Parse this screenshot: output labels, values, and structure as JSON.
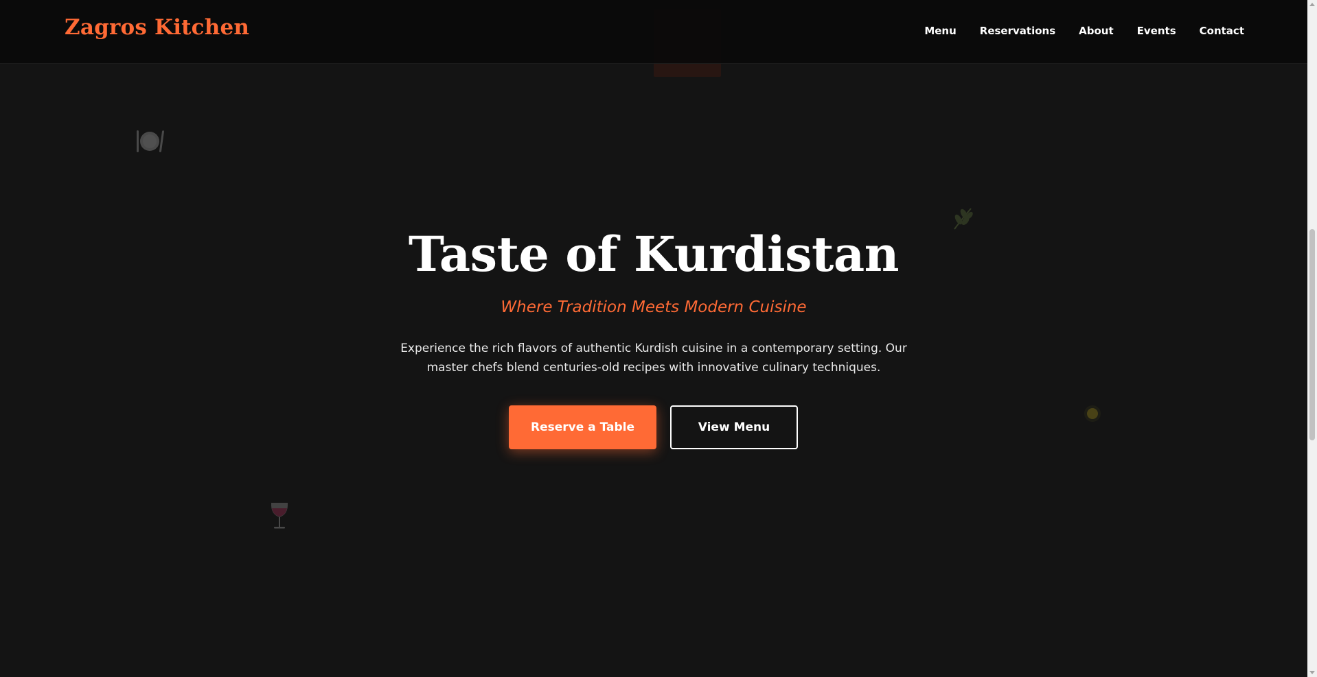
{
  "navbar": {
    "logo": "Zagros Kitchen",
    "links": [
      "Menu",
      "Reservations",
      "About",
      "Events",
      "Contact"
    ]
  },
  "hero": {
    "title": "Taste of Kurdistan",
    "subtitle": "Where Tradition Meets Modern Cuisine",
    "description": "Experience the rich flavors of authentic Kurdish cuisine in a contemporary setting. Our master chefs blend centuries-old recipes with innovative culinary techniques.",
    "primary_button": "Reserve a Table",
    "secondary_button": "View Menu"
  },
  "decorations": [
    "plate-cutlery-icon",
    "herb-leaf-icon",
    "lemon-icon",
    "wine-glass-icon"
  ],
  "colors": {
    "background": "#141414",
    "accent": "#ff6a35",
    "text": "#ffffff"
  }
}
